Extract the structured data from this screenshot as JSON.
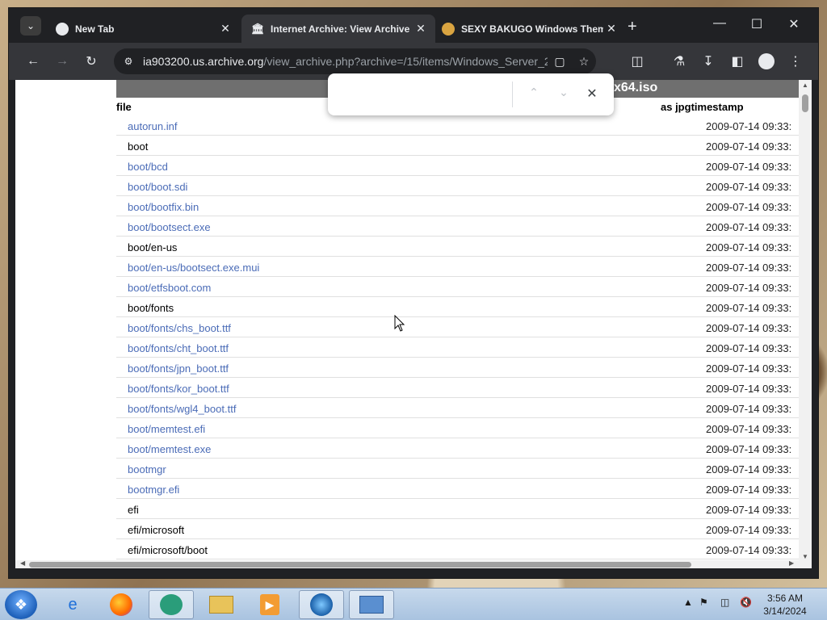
{
  "tabs": [
    {
      "title": "New Tab",
      "active": false,
      "icon": "globe-icon"
    },
    {
      "title": "Internet Archive: View Archive",
      "active": true,
      "icon": "archive-icon"
    },
    {
      "title": "SEXY BAKUGO Windows Them",
      "active": false,
      "icon": "theme-icon"
    }
  ],
  "address": {
    "host": "ia903200.us.archive.org",
    "path": "/view_archive.php?archive=/15/items/Windows_Server_20..."
  },
  "page": {
    "title_fragment": "x64.iso",
    "header_file": "file",
    "header_ts": "as jpgtimestamp",
    "rows": [
      {
        "name": "autorun.inf",
        "link": true,
        "ts": "2009-07-14 09:33:"
      },
      {
        "name": "boot",
        "link": false,
        "ts": "2009-07-14 09:33:"
      },
      {
        "name": "boot/bcd",
        "link": true,
        "ts": "2009-07-14 09:33:"
      },
      {
        "name": "boot/boot.sdi",
        "link": true,
        "ts": "2009-07-14 09:33:"
      },
      {
        "name": "boot/bootfix.bin",
        "link": true,
        "ts": "2009-07-14 09:33:"
      },
      {
        "name": "boot/bootsect.exe",
        "link": true,
        "ts": "2009-07-14 09:33:"
      },
      {
        "name": "boot/en-us",
        "link": false,
        "ts": "2009-07-14 09:33:"
      },
      {
        "name": "boot/en-us/bootsect.exe.mui",
        "link": true,
        "ts": "2009-07-14 09:33:"
      },
      {
        "name": "boot/etfsboot.com",
        "link": true,
        "ts": "2009-07-14 09:33:"
      },
      {
        "name": "boot/fonts",
        "link": false,
        "ts": "2009-07-14 09:33:"
      },
      {
        "name": "boot/fonts/chs_boot.ttf",
        "link": true,
        "ts": "2009-07-14 09:33:"
      },
      {
        "name": "boot/fonts/cht_boot.ttf",
        "link": true,
        "ts": "2009-07-14 09:33:"
      },
      {
        "name": "boot/fonts/jpn_boot.ttf",
        "link": true,
        "ts": "2009-07-14 09:33:"
      },
      {
        "name": "boot/fonts/kor_boot.ttf",
        "link": true,
        "ts": "2009-07-14 09:33:"
      },
      {
        "name": "boot/fonts/wgl4_boot.ttf",
        "link": true,
        "ts": "2009-07-14 09:33:"
      },
      {
        "name": "boot/memtest.efi",
        "link": true,
        "ts": "2009-07-14 09:33:"
      },
      {
        "name": "boot/memtest.exe",
        "link": true,
        "ts": "2009-07-14 09:33:"
      },
      {
        "name": "bootmgr",
        "link": true,
        "ts": "2009-07-14 09:33:"
      },
      {
        "name": "bootmgr.efi",
        "link": true,
        "ts": "2009-07-14 09:33:"
      },
      {
        "name": "efi",
        "link": false,
        "ts": "2009-07-14 09:33:"
      },
      {
        "name": "efi/microsoft",
        "link": false,
        "ts": "2009-07-14 09:33:"
      },
      {
        "name": "efi/microsoft/boot",
        "link": false,
        "ts": "2009-07-14 09:33:"
      }
    ]
  },
  "findbar": {
    "value": ""
  },
  "taskbar": {
    "apps": [
      "internet-explorer-icon",
      "firefox-icon",
      "chat-app-icon",
      "file-explorer-icon",
      "media-player-icon",
      "download-manager-icon",
      "control-panel-icon"
    ],
    "time": "3:56 AM",
    "date": "3/14/2024"
  },
  "colors": {
    "link": "#4b6cb7",
    "title_bar": "#6f6f6f",
    "chrome_dark": "#202124"
  }
}
